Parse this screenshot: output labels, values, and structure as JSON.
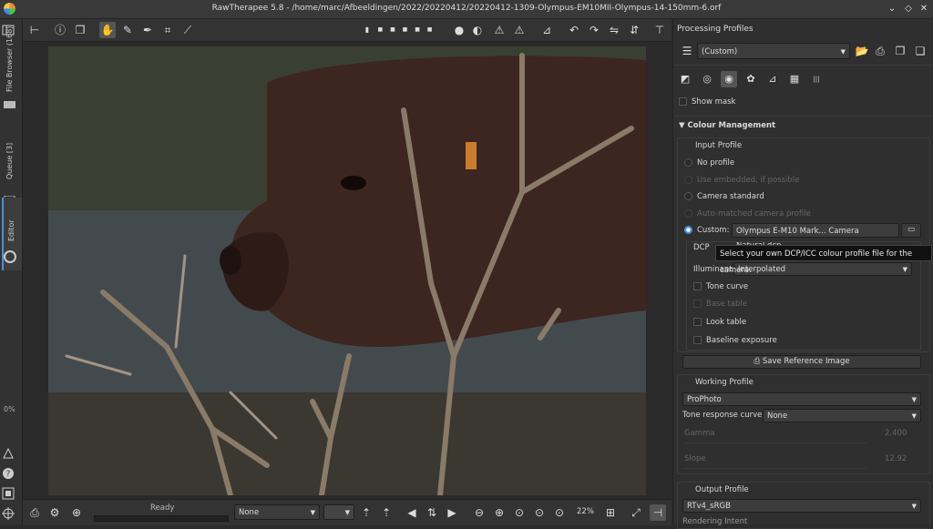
{
  "window": {
    "title": "RawTherapee 5.8 - /home/marc/Afbeeldingen/2022/20220412/20220412-1309-Olympus-EM10MII-Olympus-14-150mm-6.orf",
    "controls": {
      "minimize": "⌄",
      "restore": "◇",
      "close": "✕"
    }
  },
  "left_tabs": {
    "file_browser": "File Browser (168)",
    "queue": "Queue [3]",
    "editor": "Editor",
    "progress": "0%"
  },
  "toolbar_icons": [
    "hand-icon",
    "picker-icon",
    "crop-icon",
    "straighten-icon",
    "rotate-icon"
  ],
  "bottom": {
    "status": "Ready",
    "preview_mode": "None",
    "zoom": "22%"
  },
  "panel": {
    "processing_profiles_title": "Processing Profiles",
    "profile_value": "(Custom)",
    "show_mask": "Show mask",
    "colour_management_title": "Colour Management",
    "input_profile": {
      "title": "Input Profile",
      "no_profile": "No profile",
      "use_embedded": "Use embedded, if possible",
      "camera_standard": "Camera standard",
      "auto_matched": "Auto-matched camera profile",
      "custom_label": "Custom:",
      "custom_value": "Olympus E-M10 Mark... Camera Natural.dcp",
      "dcp": {
        "title": "DCP",
        "illuminant_label": "Illuminant:",
        "illuminant_value": "Interpolated",
        "tone_curve": "Tone curve",
        "base_table": "Base table",
        "look_table": "Look table",
        "baseline_exposure": "Baseline exposure"
      }
    },
    "save_reference": "Save Reference Image",
    "working_profile": {
      "title": "Working Profile",
      "value": "ProPhoto",
      "trc_label": "Tone response curve:",
      "trc_value": "None",
      "gamma_label": "Gamma",
      "gamma_value": "2.400",
      "slope_label": "Slope",
      "slope_value": "12.92"
    },
    "output_profile": {
      "title": "Output Profile",
      "value": "RTv4_sRGB",
      "rendering_intent": "Rendering Intent"
    }
  },
  "tooltip": "Select your own DCP/ICC colour profile file for the camera."
}
